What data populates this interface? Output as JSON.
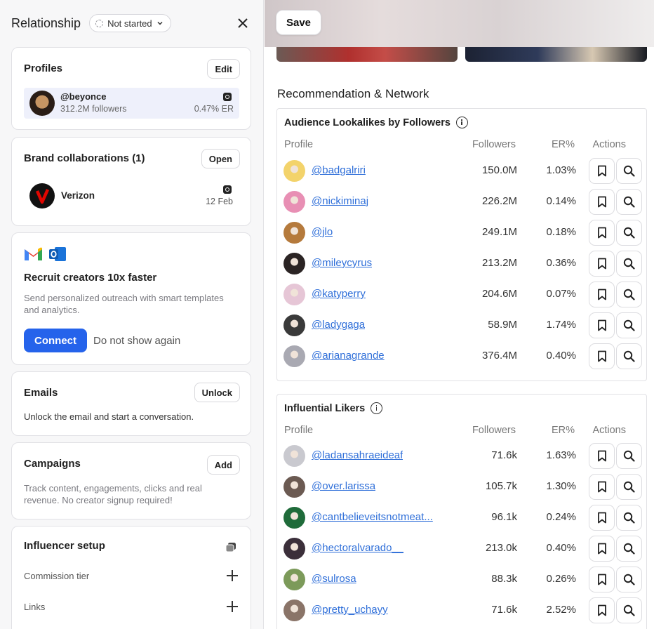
{
  "header": {
    "title": "Relationship",
    "status": "Not started"
  },
  "profiles": {
    "title": "Profiles",
    "edit_label": "Edit",
    "item": {
      "handle": "@beyonce",
      "followers": "312.2M followers",
      "er": "0.47% ER"
    }
  },
  "brand": {
    "title": "Brand collaborations (1)",
    "open_label": "Open",
    "item": {
      "name": "Verizon",
      "date": "12 Feb",
      "logo_color": "#e10600"
    }
  },
  "recruit": {
    "title": "Recruit creators 10x faster",
    "description": "Send personalized outreach with smart templates and analytics.",
    "connect_label": "Connect",
    "dismiss_label": "Do not show again",
    "accent": "#2563eb"
  },
  "emails": {
    "title": "Emails",
    "unlock_label": "Unlock",
    "description": "Unlock the email and start a conversation."
  },
  "campaigns": {
    "title": "Campaigns",
    "add_label": "Add",
    "description": "Track content, engagements, clicks and real revenue. No creator signup required!"
  },
  "setup": {
    "title": "Influencer setup",
    "rows": [
      "Commission tier",
      "Links"
    ]
  },
  "toolbar": {
    "save_label": "Save"
  },
  "recommendation": {
    "title": "Recommendation & Network",
    "lookalikes": {
      "title": "Audience Lookalikes by Followers",
      "columns": [
        "Profile",
        "Followers",
        "ER%",
        "Actions"
      ],
      "rows": [
        {
          "handle": "@badgalriri",
          "followers": "150.0M",
          "er": "1.03%",
          "avatar_color": "#f3d36b"
        },
        {
          "handle": "@nickiminaj",
          "followers": "226.2M",
          "er": "0.14%",
          "avatar_color": "#e88fb4"
        },
        {
          "handle": "@jlo",
          "followers": "249.1M",
          "er": "0.18%",
          "avatar_color": "#b57a3c"
        },
        {
          "handle": "@mileycyrus",
          "followers": "213.2M",
          "er": "0.36%",
          "avatar_color": "#2b2424"
        },
        {
          "handle": "@katyperry",
          "followers": "204.6M",
          "er": "0.07%",
          "avatar_color": "#e6c6d6"
        },
        {
          "handle": "@ladygaga",
          "followers": "58.9M",
          "er": "1.74%",
          "avatar_color": "#3a3a3a"
        },
        {
          "handle": "@arianagrande",
          "followers": "376.4M",
          "er": "0.40%",
          "avatar_color": "#a9a9b2"
        }
      ]
    },
    "likers": {
      "title": "Influential Likers",
      "columns": [
        "Profile",
        "Followers",
        "ER%",
        "Actions"
      ],
      "rows": [
        {
          "handle": "@ladansahraeideaf",
          "followers": "71.6k",
          "er": "1.63%",
          "avatar_color": "#c9c9cf"
        },
        {
          "handle": "@over.larissa",
          "followers": "105.7k",
          "er": "1.30%",
          "avatar_color": "#6b5a52"
        },
        {
          "handle": "@cantbelieveitsnotmeat...",
          "followers": "96.1k",
          "er": "0.24%",
          "avatar_color": "#1f6b3a"
        },
        {
          "handle": "@hectoralvarado__",
          "followers": "213.0k",
          "er": "0.40%",
          "avatar_color": "#3b2f3a"
        },
        {
          "handle": "@sulrosa",
          "followers": "88.3k",
          "er": "0.26%",
          "avatar_color": "#7c9a5a"
        },
        {
          "handle": "@pretty_uchayy",
          "followers": "71.6k",
          "er": "2.52%",
          "avatar_color": "#8a7468"
        }
      ]
    }
  }
}
